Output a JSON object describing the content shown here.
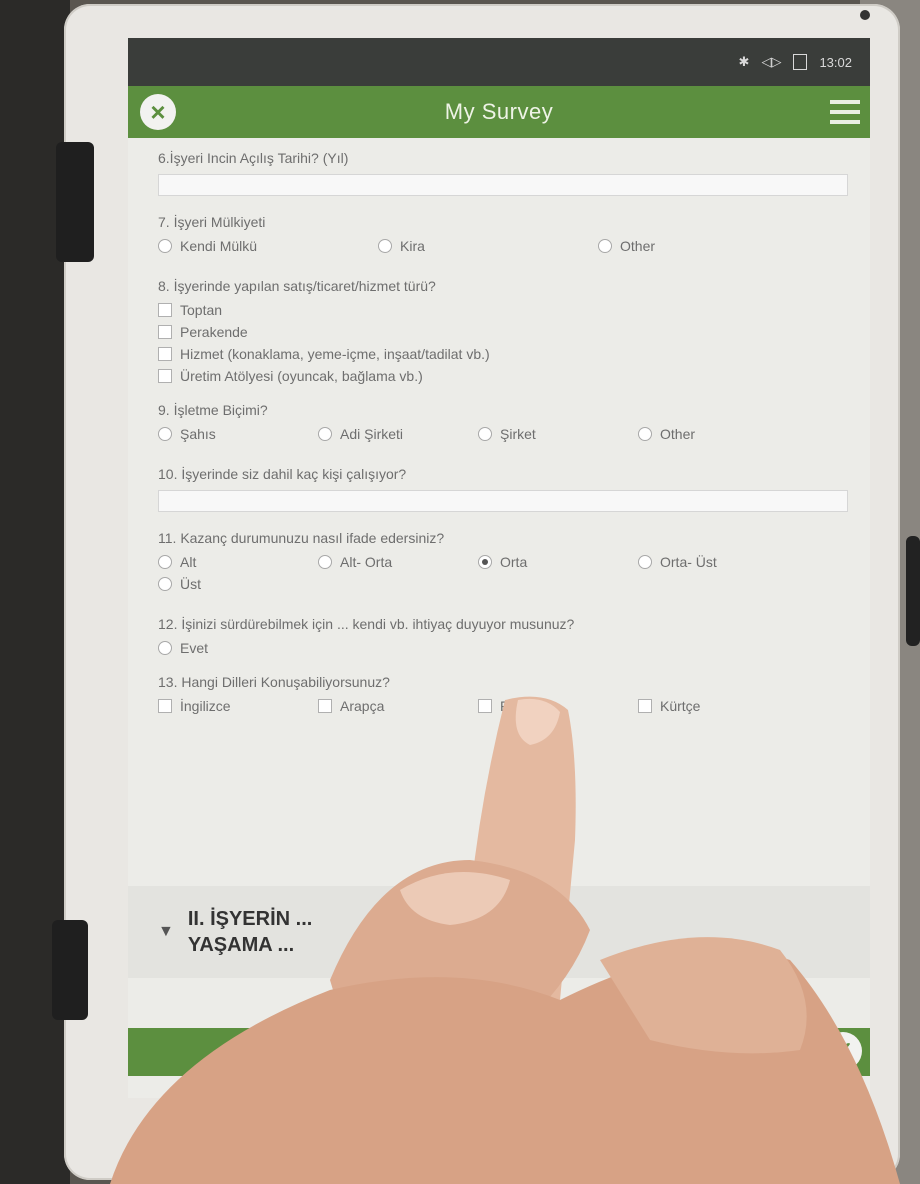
{
  "status": {
    "time": "13:02"
  },
  "app": {
    "title": "My Survey"
  },
  "questions": {
    "q6": {
      "label": "6.İşyeri Incin Açılış Tarihi? (Yıl)"
    },
    "q7": {
      "label": "7. İşyeri Mülkiyeti",
      "options": [
        "Kendi Mülkü",
        "Kira",
        "Other"
      ]
    },
    "q8": {
      "label": "8. İşyerinde yapılan satış/ticaret/hizmet türü?",
      "options": [
        "Toptan",
        "Perakende",
        "Hizmet (konaklama, yeme-içme, inşaat/tadilat vb.)",
        "Üretim Atölyesi (oyuncak, bağlama vb.)"
      ]
    },
    "q9": {
      "label": "9. İşletme Biçimi?",
      "options": [
        "Şahıs",
        "Adi Şirketi",
        "Şirket",
        "Other"
      ]
    },
    "q10": {
      "label": "10. İşyerinde siz dahil kaç kişi çalışıyor?"
    },
    "q11": {
      "label": "11. Kazanç durumunuzu nasıl ifade edersiniz?",
      "options": [
        "Alt",
        "Alt- Orta",
        "Orta",
        "Orta- Üst",
        "Üst"
      ],
      "selected": "Orta"
    },
    "q12": {
      "label": "12. İşinizi sürdürebilmek için ... kendi vb. ihtiyaç duyuyor musunuz?",
      "options": [
        "Evet"
      ]
    },
    "q13": {
      "label": "13. Hangi Dilleri Konuşabiliyorsunuz?",
      "options": [
        "İngilizce",
        "Arapça",
        "Farsça",
        "Kürtçe"
      ]
    }
  },
  "section": {
    "line1": "II. İŞYERİN ...",
    "line2": "YAŞAMA ..."
  }
}
